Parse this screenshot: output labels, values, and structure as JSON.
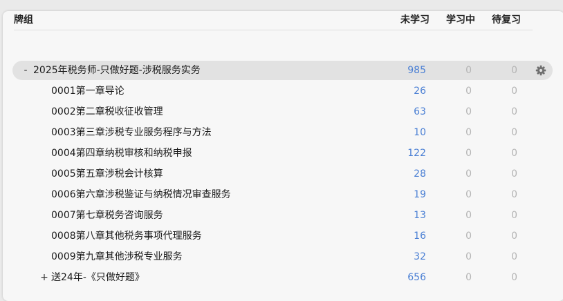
{
  "header": {
    "deck": "牌组",
    "new": "未学习",
    "learn": "学习中",
    "due": "待复习"
  },
  "decks": [
    {
      "toggle": "-",
      "name": "2025年税务师-只做好题-涉税服务实务",
      "new": "985",
      "learn": "0",
      "due": "0",
      "selected": true,
      "gear_icon": "gear-icon"
    },
    {
      "toggle": "",
      "name": "0001第一章导论",
      "new": "26",
      "learn": "0",
      "due": "0"
    },
    {
      "toggle": "",
      "name": "0002第二章税收征收管理",
      "new": "63",
      "learn": "0",
      "due": "0"
    },
    {
      "toggle": "",
      "name": "0003第三章涉税专业服务程序与方法",
      "new": "10",
      "learn": "0",
      "due": "0"
    },
    {
      "toggle": "",
      "name": "0004第四章纳税审核和纳税申报",
      "new": "122",
      "learn": "0",
      "due": "0"
    },
    {
      "toggle": "",
      "name": "0005第五章涉税会计核算",
      "new": "28",
      "learn": "0",
      "due": "0"
    },
    {
      "toggle": "",
      "name": "0006第六章涉税鉴证与纳税情况审查服务",
      "new": "19",
      "learn": "0",
      "due": "0"
    },
    {
      "toggle": "",
      "name": "0007第七章税务咨询服务",
      "new": "13",
      "learn": "0",
      "due": "0"
    },
    {
      "toggle": "",
      "name": "0008第八章其他税务事项代理服务",
      "new": "16",
      "learn": "0",
      "due": "0"
    },
    {
      "toggle": "",
      "name": "0009第九章其他涉税专业服务",
      "new": "32",
      "learn": "0",
      "due": "0"
    },
    {
      "toggle": "+",
      "name": "送24年-《只做好题》",
      "new": "656",
      "learn": "0",
      "due": "0"
    }
  ]
}
